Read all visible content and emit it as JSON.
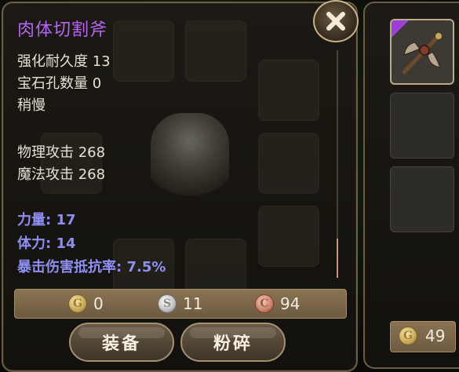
{
  "item": {
    "name": "肉体切割斧",
    "stats_block1": [
      "强化耐久度 13",
      "宝石孔数量 0",
      "稍慢"
    ],
    "stats_block2": [
      "物理攻击 268",
      "魔法攻击 268"
    ],
    "attributes": [
      "力量: 17",
      "体力: 14",
      "暴击伤害抵抗率: 7.5%"
    ]
  },
  "price": {
    "gold": "0",
    "silver": "11",
    "copper": "94"
  },
  "buttons": {
    "equip": "装备",
    "smash": "粉碎"
  },
  "coin_letters": {
    "gold": "G",
    "silver": "S",
    "copper": "C"
  },
  "side_panel": {
    "gold": "49"
  },
  "colors": {
    "item_name": "#b566f0",
    "attribute_text": "#8f8ff2",
    "rarity_corner": "#9b3fd6"
  },
  "icons": [
    "close-icon",
    "gold-coin-icon",
    "silver-coin-icon",
    "copper-coin-icon",
    "axe-icon"
  ]
}
